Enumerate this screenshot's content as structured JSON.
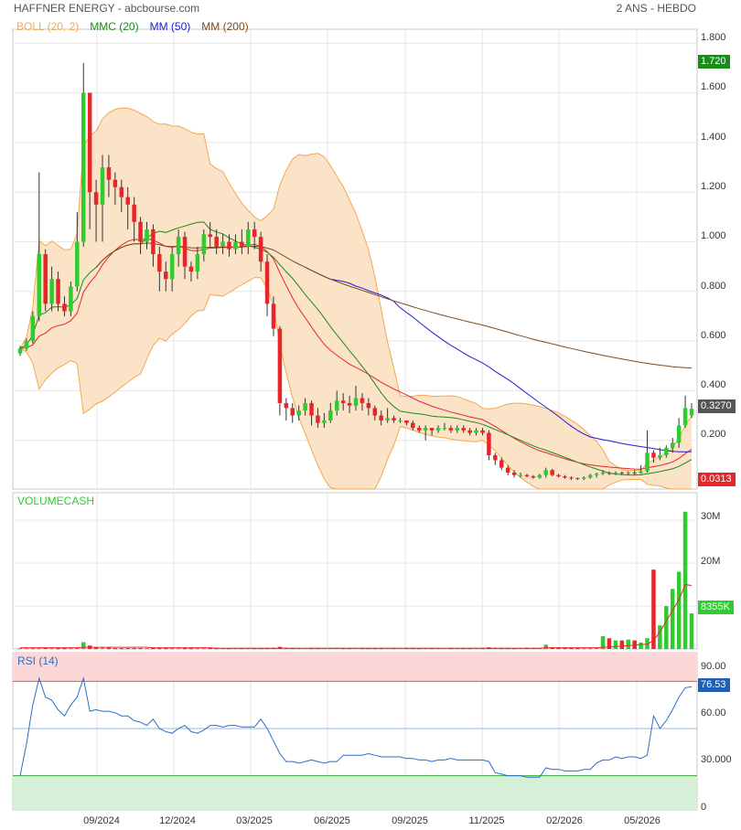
{
  "header": {
    "title": "HAFFNER ENERGY - abcbourse.com",
    "period": "2 ANS - HEBDO"
  },
  "colors": {
    "up": "#2ecc2e",
    "down": "#e8262a",
    "boll_fill": "#fbe3c8",
    "boll_line": "#f4a94a",
    "mmc20": "#1a8c1a",
    "mm50": "#1c1cd8",
    "mm200": "#7b4a21",
    "rsi": "#2a6fc6",
    "vol_ma": "#e8262a"
  },
  "chart_data": [
    {
      "type": "candlestick",
      "legend": [
        "BOLL (20, 2)",
        "MMC (20)",
        "MM (50)",
        "MM (200)"
      ],
      "y_ticks": [
        "1.800",
        "1.600",
        "1.400",
        "1.200",
        "1.000",
        "0.800",
        "0.600",
        "0.400",
        "0.200"
      ],
      "ylim": [
        0.0,
        1.85
      ],
      "x_ticks": [
        "09/2024",
        "12/2024",
        "03/2025",
        "06/2025",
        "09/2025",
        "11/2025",
        "02/2026",
        "05/2026"
      ],
      "last_price_label": "0.3270",
      "upper_badge": "1.720",
      "lower_badge": "0.0313",
      "candles": [
        [
          0.55,
          0.57,
          0.58,
          0.54
        ],
        [
          0.57,
          0.6,
          0.61,
          0.56
        ],
        [
          0.6,
          0.7,
          0.72,
          0.59
        ],
        [
          0.7,
          0.95,
          1.28,
          0.68
        ],
        [
          0.95,
          0.75,
          0.97,
          0.72
        ],
        [
          0.75,
          0.85,
          0.9,
          0.72
        ],
        [
          0.85,
          0.75,
          0.88,
          0.72
        ],
        [
          0.75,
          0.72,
          0.78,
          0.7
        ],
        [
          0.72,
          0.82,
          0.84,
          0.7
        ],
        [
          0.82,
          1.0,
          1.12,
          0.8
        ],
        [
          1.0,
          1.6,
          1.72,
          0.98
        ],
        [
          1.6,
          1.2,
          1.6,
          1.05
        ],
        [
          1.2,
          1.15,
          1.25,
          1.0
        ],
        [
          1.15,
          1.3,
          1.35,
          1.0
        ],
        [
          1.3,
          1.25,
          1.35,
          1.18
        ],
        [
          1.25,
          1.22,
          1.28,
          1.15
        ],
        [
          1.22,
          1.18,
          1.25,
          1.12
        ],
        [
          1.18,
          1.15,
          1.22,
          1.05
        ],
        [
          1.15,
          1.08,
          1.18,
          1.0
        ],
        [
          1.08,
          1.0,
          1.1,
          0.95
        ],
        [
          1.0,
          1.05,
          1.08,
          0.97
        ],
        [
          1.05,
          0.95,
          1.07,
          0.9
        ],
        [
          0.95,
          0.88,
          0.98,
          0.8
        ],
        [
          0.88,
          0.85,
          0.92,
          0.8
        ],
        [
          0.85,
          0.95,
          0.98,
          0.8
        ],
        [
          0.95,
          1.02,
          1.05,
          0.9
        ],
        [
          1.02,
          0.9,
          1.04,
          0.85
        ],
        [
          0.9,
          0.88,
          0.92,
          0.84
        ],
        [
          0.88,
          0.95,
          0.98,
          0.85
        ],
        [
          0.95,
          1.03,
          1.05,
          0.92
        ],
        [
          1.03,
          1.02,
          1.08,
          0.98
        ],
        [
          1.02,
          0.98,
          1.05,
          0.95
        ],
        [
          0.98,
          1.0,
          1.03,
          0.95
        ],
        [
          1.0,
          0.97,
          1.03,
          0.94
        ],
        [
          0.97,
          1.0,
          1.03,
          0.95
        ],
        [
          1.0,
          0.98,
          1.05,
          0.95
        ],
        [
          0.98,
          1.05,
          1.08,
          0.95
        ],
        [
          1.05,
          1.02,
          1.08,
          0.97
        ],
        [
          1.02,
          0.92,
          1.04,
          0.88
        ],
        [
          0.92,
          0.75,
          0.95,
          0.7
        ],
        [
          0.75,
          0.65,
          0.78,
          0.62
        ],
        [
          0.65,
          0.35,
          0.66,
          0.3
        ],
        [
          0.35,
          0.33,
          0.37,
          0.28
        ],
        [
          0.33,
          0.3,
          0.35,
          0.27
        ],
        [
          0.3,
          0.32,
          0.34,
          0.28
        ],
        [
          0.32,
          0.35,
          0.37,
          0.3
        ],
        [
          0.35,
          0.3,
          0.36,
          0.26
        ],
        [
          0.3,
          0.27,
          0.33,
          0.25
        ],
        [
          0.27,
          0.28,
          0.31,
          0.25
        ],
        [
          0.28,
          0.32,
          0.35,
          0.27
        ],
        [
          0.32,
          0.36,
          0.4,
          0.3
        ],
        [
          0.36,
          0.35,
          0.39,
          0.32
        ],
        [
          0.35,
          0.34,
          0.38,
          0.31
        ],
        [
          0.34,
          0.37,
          0.42,
          0.32
        ],
        [
          0.37,
          0.35,
          0.39,
          0.32
        ],
        [
          0.35,
          0.33,
          0.37,
          0.3
        ],
        [
          0.33,
          0.3,
          0.34,
          0.28
        ],
        [
          0.3,
          0.28,
          0.32,
          0.26
        ],
        [
          0.28,
          0.29,
          0.33,
          0.27
        ],
        [
          0.29,
          0.28,
          0.3,
          0.27
        ],
        [
          0.28,
          0.28,
          0.29,
          0.27
        ],
        [
          0.28,
          0.27,
          0.28,
          0.26
        ],
        [
          0.27,
          0.25,
          0.28,
          0.24
        ],
        [
          0.25,
          0.24,
          0.26,
          0.23
        ],
        [
          0.24,
          0.25,
          0.26,
          0.2
        ],
        [
          0.25,
          0.24,
          0.25,
          0.22
        ],
        [
          0.24,
          0.25,
          0.26,
          0.23
        ],
        [
          0.25,
          0.25,
          0.27,
          0.24
        ],
        [
          0.25,
          0.24,
          0.26,
          0.23
        ],
        [
          0.24,
          0.25,
          0.26,
          0.23
        ],
        [
          0.25,
          0.24,
          0.26,
          0.23
        ],
        [
          0.24,
          0.23,
          0.25,
          0.22
        ],
        [
          0.23,
          0.24,
          0.25,
          0.22
        ],
        [
          0.24,
          0.23,
          0.25,
          0.22
        ],
        [
          0.23,
          0.14,
          0.24,
          0.12
        ],
        [
          0.14,
          0.12,
          0.15,
          0.1
        ],
        [
          0.12,
          0.09,
          0.13,
          0.08
        ],
        [
          0.09,
          0.07,
          0.1,
          0.06
        ],
        [
          0.07,
          0.06,
          0.08,
          0.05
        ],
        [
          0.06,
          0.06,
          0.07,
          0.05
        ],
        [
          0.06,
          0.055,
          0.065,
          0.05
        ],
        [
          0.055,
          0.05,
          0.06,
          0.045
        ],
        [
          0.05,
          0.06,
          0.065,
          0.045
        ],
        [
          0.06,
          0.08,
          0.09,
          0.05
        ],
        [
          0.08,
          0.06,
          0.085,
          0.055
        ],
        [
          0.06,
          0.055,
          0.065,
          0.05
        ],
        [
          0.055,
          0.05,
          0.06,
          0.045
        ],
        [
          0.05,
          0.048,
          0.055,
          0.04
        ],
        [
          0.048,
          0.045,
          0.05,
          0.04
        ],
        [
          0.045,
          0.05,
          0.055,
          0.04
        ],
        [
          0.05,
          0.06,
          0.065,
          0.045
        ],
        [
          0.06,
          0.065,
          0.07,
          0.05
        ],
        [
          0.065,
          0.07,
          0.08,
          0.06
        ],
        [
          0.07,
          0.065,
          0.075,
          0.06
        ],
        [
          0.065,
          0.07,
          0.075,
          0.06
        ],
        [
          0.07,
          0.068,
          0.075,
          0.06
        ],
        [
          0.068,
          0.07,
          0.075,
          0.06
        ],
        [
          0.07,
          0.068,
          0.08,
          0.06
        ],
        [
          0.068,
          0.075,
          0.1,
          0.065
        ],
        [
          0.075,
          0.15,
          0.24,
          0.07
        ],
        [
          0.15,
          0.13,
          0.16,
          0.11
        ],
        [
          0.13,
          0.14,
          0.17,
          0.12
        ],
        [
          0.14,
          0.17,
          0.18,
          0.13
        ],
        [
          0.17,
          0.19,
          0.21,
          0.15
        ],
        [
          0.19,
          0.26,
          0.29,
          0.17
        ],
        [
          0.26,
          0.33,
          0.38,
          0.25
        ],
        [
          0.3,
          0.327,
          0.35,
          0.29
        ]
      ]
    },
    {
      "type": "bar",
      "legend": [
        "VOLUMECASH"
      ],
      "y_ticks": [
        "30M",
        "20M"
      ],
      "ylim": [
        0,
        36
      ],
      "last_value_label": "8355K",
      "values": [
        0.2,
        0.2,
        0.2,
        0.3,
        0.3,
        0.2,
        0.2,
        0.2,
        0.2,
        0.3,
        1.6,
        0.8,
        0.4,
        0.3,
        0.3,
        0.2,
        0.2,
        0.2,
        0.2,
        0.2,
        0.2,
        0.2,
        0.2,
        0.2,
        0.2,
        0.2,
        0.2,
        0.2,
        0.2,
        0.2,
        0.2,
        0.2,
        0.2,
        0.2,
        0.2,
        0.2,
        0.2,
        0.2,
        0.2,
        0.2,
        0.3,
        0.5,
        0.3,
        0.2,
        0.2,
        0.2,
        0.2,
        0.2,
        0.2,
        0.3,
        0.3,
        0.2,
        0.2,
        0.3,
        0.2,
        0.2,
        0.2,
        0.2,
        0.2,
        0.2,
        0.2,
        0.2,
        0.2,
        0.2,
        0.2,
        0.2,
        0.2,
        0.2,
        0.2,
        0.2,
        0.2,
        0.2,
        0.2,
        0.2,
        0.4,
        0.3,
        0.2,
        0.2,
        0.2,
        0.2,
        0.3,
        0.2,
        0.2,
        1.0,
        0.4,
        0.3,
        0.3,
        0.2,
        0.2,
        0.2,
        0.3,
        0.4,
        3.0,
        2.5,
        2.0,
        2.0,
        2.2,
        2.0,
        1.5,
        2.5,
        18.5,
        5.5,
        10.0,
        14.0,
        18.0,
        32.0,
        8.3
      ],
      "ma_values": [
        0.3,
        0.3,
        0.3,
        0.3,
        0.3,
        0.3,
        0.3,
        0.3,
        0.3,
        0.3,
        0.4,
        0.4,
        0.4,
        0.4,
        0.4,
        0.4,
        0.4,
        0.4,
        0.4,
        0.4,
        0.4,
        0.3,
        0.3,
        0.3,
        0.3,
        0.3,
        0.3,
        0.3,
        0.3,
        0.3,
        0.3,
        0.2,
        0.2,
        0.2,
        0.2,
        0.2,
        0.2,
        0.2,
        0.2,
        0.2,
        0.2,
        0.2,
        0.2,
        0.2,
        0.2,
        0.2,
        0.2,
        0.2,
        0.2,
        0.2,
        0.2,
        0.2,
        0.2,
        0.2,
        0.2,
        0.2,
        0.2,
        0.2,
        0.2,
        0.2,
        0.2,
        0.2,
        0.2,
        0.2,
        0.2,
        0.2,
        0.2,
        0.2,
        0.2,
        0.2,
        0.2,
        0.2,
        0.2,
        0.2,
        0.2,
        0.2,
        0.2,
        0.2,
        0.2,
        0.2,
        0.2,
        0.2,
        0.2,
        0.3,
        0.3,
        0.3,
        0.3,
        0.3,
        0.3,
        0.3,
        0.3,
        0.3,
        0.4,
        0.5,
        0.6,
        0.7,
        0.8,
        0.9,
        1.0,
        1.1,
        2.0,
        4.0,
        6.5,
        9.0,
        11.5,
        15.0,
        14.8
      ]
    },
    {
      "type": "line",
      "legend": [
        "RSI (14)"
      ],
      "y_ticks": [
        "90.00",
        "60.00",
        "30.000",
        "0"
      ],
      "ylim": [
        0,
        100
      ],
      "overbought": 80,
      "oversold": 20,
      "mid_line": 50,
      "last_value_label": "76.53",
      "values": [
        20,
        40,
        65,
        82,
        70,
        68,
        62,
        58,
        65,
        70,
        82,
        61,
        62,
        61,
        61,
        60,
        58,
        58,
        55,
        54,
        52,
        56,
        50,
        48,
        47,
        50,
        52,
        48,
        47,
        49,
        52,
        52,
        51,
        52,
        52,
        51,
        51,
        51,
        56,
        50,
        42,
        34,
        29,
        29,
        28,
        29,
        30,
        29,
        28,
        29,
        29,
        33,
        33,
        33,
        33,
        34,
        33,
        32,
        32,
        32,
        32,
        31,
        31,
        30,
        30,
        29,
        30,
        30,
        31,
        30,
        30,
        30,
        30,
        30,
        29,
        22,
        21,
        20,
        20,
        20,
        19,
        19,
        19,
        25,
        24,
        24,
        23,
        23,
        23,
        24,
        24,
        28,
        30,
        30,
        32,
        31,
        32,
        32,
        31,
        33,
        58,
        50,
        55,
        62,
        70,
        76,
        76.53
      ]
    }
  ]
}
